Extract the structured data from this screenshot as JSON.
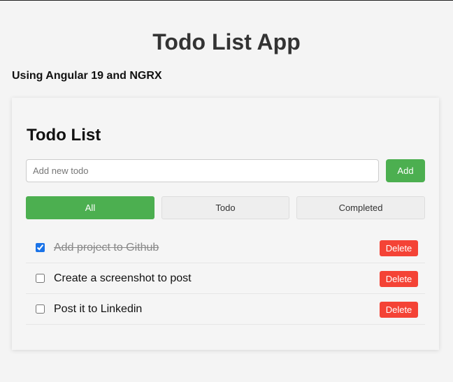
{
  "app": {
    "title": "Todo List App",
    "subtitle": "Using Angular 19 and NGRX"
  },
  "card": {
    "title": "Todo List",
    "input": {
      "placeholder": "Add new todo",
      "value": ""
    },
    "add_label": "Add"
  },
  "filters": [
    {
      "label": "All",
      "active": true
    },
    {
      "label": "Todo",
      "active": false
    },
    {
      "label": "Completed",
      "active": false
    }
  ],
  "todos": [
    {
      "text": "Add project to Github",
      "completed": true,
      "delete_label": "Delete"
    },
    {
      "text": "Create a screenshot to post",
      "completed": false,
      "delete_label": "Delete"
    },
    {
      "text": "Post it to Linkedin",
      "completed": false,
      "delete_label": "Delete"
    }
  ],
  "colors": {
    "accent": "#4caf50",
    "danger": "#f44336",
    "background": "#f4f4f4"
  }
}
